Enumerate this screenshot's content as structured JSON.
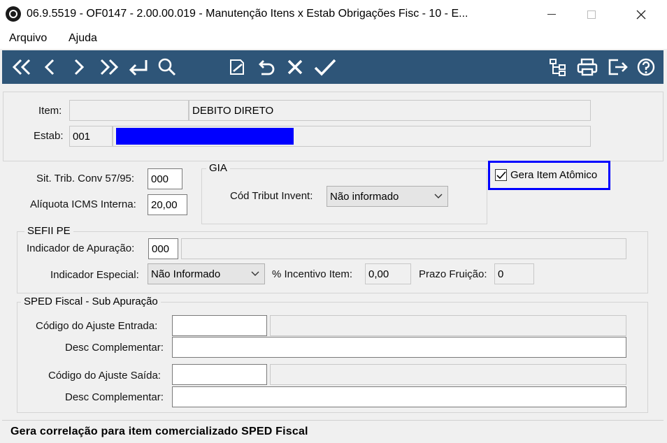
{
  "window": {
    "title": "06.9.5519 - OF0147 - 2.00.00.019 - Manutenção Itens x Estab Obrigações Fisc - 10 - E...",
    "minimize": "—",
    "maximize": "☐",
    "close": "✕"
  },
  "menu": {
    "items": [
      "Arquivo",
      "Ajuda"
    ]
  },
  "toolbar": {
    "icons": [
      "first-record-icon",
      "previous-record-icon",
      "next-record-icon",
      "last-record-icon",
      "goto-icon",
      "search-icon",
      "edit-icon",
      "undo-icon",
      "cancel-icon",
      "confirm-icon",
      "tree-icon",
      "print-icon",
      "exit-icon",
      "help-icon"
    ],
    "accent": "#2e5578"
  },
  "header": {
    "item_label": "Item:",
    "item_code": "",
    "item_desc": "DEBITO DIRETO",
    "estab_label": "Estab:",
    "estab_code": "001",
    "estab_desc_color": "#0000ff"
  },
  "fiscal": {
    "sit_trib_label": "Sit. Trib. Conv 57/95:",
    "sit_trib_value": "000",
    "aliquota_label": "Alíquota ICMS Interna:",
    "aliquota_value": "20,00"
  },
  "gia": {
    "title": "GIA",
    "cod_tribut_label": "Cód Tribut Invent:",
    "cod_tribut_value": "Não informado"
  },
  "gera_item": {
    "label": "Gera Item Atômico",
    "checked": true,
    "highlight_color": "#0000ff"
  },
  "sefii": {
    "title": "SEFII PE",
    "ind_apuracao_label": "Indicador de Apuração:",
    "ind_apuracao_value": "000",
    "ind_apuracao_desc": "",
    "ind_especial_label": "Indicador Especial:",
    "ind_especial_value": "Não Informado",
    "incentivo_label": "% Incentivo Item:",
    "incentivo_value": "0,00",
    "prazo_label": "Prazo Fruição:",
    "prazo_value": "0"
  },
  "sped": {
    "title": "SPED Fiscal - Sub Apuração",
    "ajuste_entrada_label": "Código do Ajuste Entrada:",
    "ajuste_entrada_value": "",
    "desc_entrada_label": "Desc Complementar:",
    "desc_entrada_value": "",
    "ajuste_saida_label": "Código do Ajuste Saída:",
    "ajuste_saida_value": "",
    "desc_saida_label": "Desc Complementar:",
    "desc_saida_value": ""
  },
  "status": {
    "text": "Gera correlação para item comercializado SPED Fiscal"
  }
}
